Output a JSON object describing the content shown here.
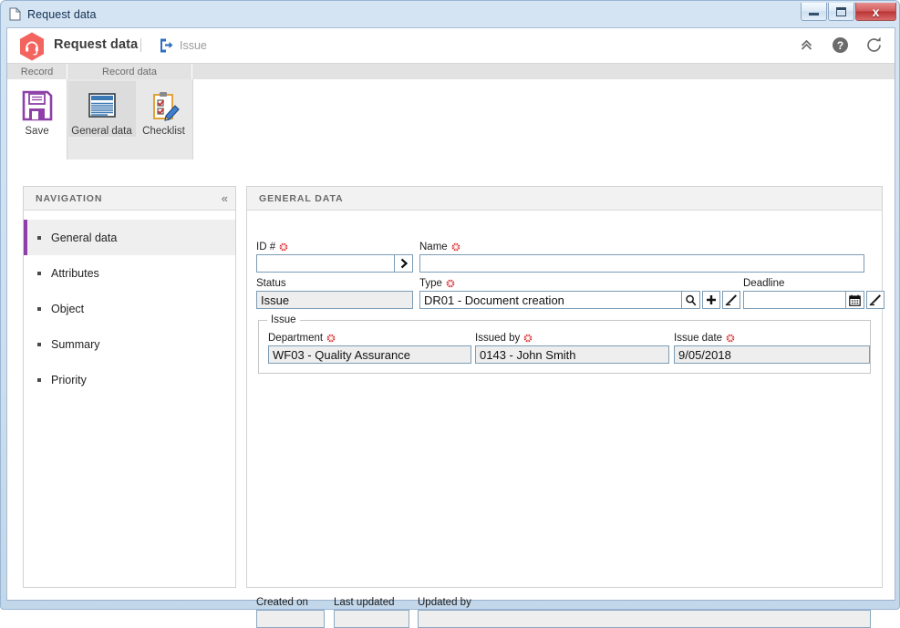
{
  "window": {
    "title": "Request data",
    "doc_icon": "document-icon",
    "buttons": {
      "minimize": "minimize-icon",
      "maximize": "maximize-icon",
      "close": "x"
    }
  },
  "app_header": {
    "logo_icon": "headset-hexagon-logo",
    "title": "Request data",
    "separator": "|",
    "breadcrumb_icon": "export-arrow-icon",
    "breadcrumb_label": "Issue",
    "actions": [
      {
        "name": "collapse-ribbon-button",
        "icon": "chevron-double-up-icon"
      },
      {
        "name": "help-button",
        "icon": "question-circle-icon"
      },
      {
        "name": "refresh-button",
        "icon": "refresh-icon"
      }
    ]
  },
  "ribbon": {
    "tabs": [
      {
        "label": "Record"
      },
      {
        "label": "Record data"
      }
    ],
    "buttons": [
      {
        "label": "Save",
        "icon": "floppy-disk-icon",
        "selected": false
      },
      {
        "label": "General data",
        "icon": "document-lines-icon",
        "selected": true
      },
      {
        "label": "Checklist",
        "icon": "clipboard-pencil-icon",
        "selected": false
      }
    ]
  },
  "navigation": {
    "title": "NAVIGATION",
    "collapse_icon": "chevron-double-left-icon",
    "items": [
      {
        "label": "General data",
        "active": true
      },
      {
        "label": "Attributes",
        "active": false
      },
      {
        "label": "Object",
        "active": false
      },
      {
        "label": "Summary",
        "active": false
      },
      {
        "label": "Priority",
        "active": false
      }
    ]
  },
  "form": {
    "title": "GENERAL DATA",
    "fields": {
      "id": {
        "label": "ID #",
        "required": true,
        "value": "",
        "button_icon": "chevron-right-icon"
      },
      "name": {
        "label": "Name",
        "required": true,
        "value": ""
      },
      "status": {
        "label": "Status",
        "required": false,
        "value": "Issue",
        "readonly": true
      },
      "type": {
        "label": "Type",
        "required": true,
        "value": "DR01 - Document creation",
        "buttons": [
          {
            "name": "type-search-button",
            "icon": "magnifier-icon"
          },
          {
            "name": "type-add-button",
            "icon": "plus-icon"
          },
          {
            "name": "type-clear-button",
            "icon": "eraser-icon"
          }
        ]
      },
      "deadline": {
        "label": "Deadline",
        "required": false,
        "value": "",
        "buttons": [
          {
            "name": "deadline-calendar-button",
            "icon": "calendar-icon"
          },
          {
            "name": "deadline-clear-button",
            "icon": "eraser-icon"
          }
        ]
      },
      "department": {
        "label": "Department",
        "required": true,
        "value": "WF03 - Quality Assurance",
        "readonly": true
      },
      "issued_by": {
        "label": "Issued by",
        "required": true,
        "value": "0143 - John Smith",
        "readonly": true
      },
      "issue_date": {
        "label": "Issue date",
        "required": true,
        "value": "9/05/2018",
        "readonly": true
      },
      "created_on": {
        "label": "Created on",
        "required": false,
        "value": "",
        "readonly": true
      },
      "last_updated": {
        "label": "Last updated",
        "required": false,
        "value": "",
        "readonly": true
      },
      "updated_by": {
        "label": "Updated by",
        "required": false,
        "value": "",
        "readonly": true
      }
    },
    "groups": {
      "issue": {
        "legend": "Issue"
      }
    }
  },
  "colors": {
    "accent_purple": "#8f3fa8",
    "logo_red": "#f4645f",
    "breadcrumb_blue": "#2f70c0",
    "required_red": "#d51c20",
    "panel_header_bg": "#f2f2f2",
    "input_border": "#7c9cb5"
  }
}
